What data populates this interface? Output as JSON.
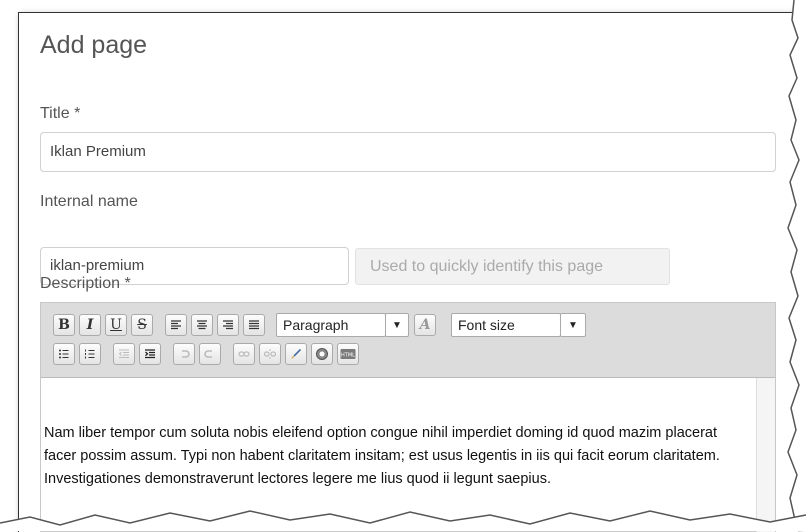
{
  "form": {
    "heading": "Add page",
    "title_label": "Title *",
    "title_value": "Iklan Premium",
    "internal_name_label": "Internal name",
    "internal_name_value": "iklan-premium",
    "internal_name_hint": "Used to quickly identify this page",
    "description_label": "Description *"
  },
  "toolbar": {
    "bold": "B",
    "italic": "I",
    "underline": "U",
    "strikethrough": "S",
    "format_select": "Paragraph",
    "font_size_select": "Font size",
    "clear_format_icon": "A"
  },
  "editor": {
    "body_text": "Nam liber tempor cum soluta nobis eleifend option congue nihil imperdiet doming id quod mazim placerat facer possim assum. Typi non habent claritatem insitam; est usus legentis in iis qui facit eorum claritatem. Investigationes demonstraverunt lectores legere me lius quod ii legunt saepius."
  }
}
